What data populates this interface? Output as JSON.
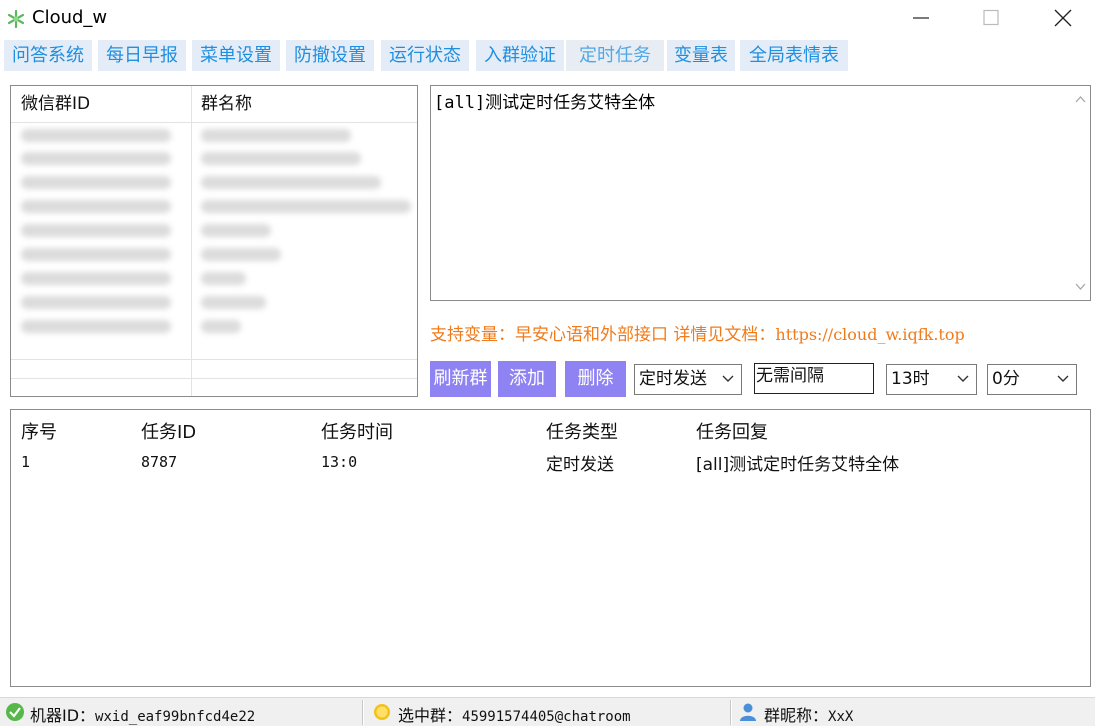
{
  "window": {
    "title": "Cloud_w",
    "app_icon": "snowflake-icon",
    "controls": [
      "minimize-icon",
      "maximize-icon",
      "close-icon"
    ]
  },
  "tabs": [
    {
      "label": "问答系统",
      "active": false
    },
    {
      "label": "每日早报",
      "active": false
    },
    {
      "label": "菜单设置",
      "active": false
    },
    {
      "label": "防撤设置",
      "active": false
    },
    {
      "label": "运行状态",
      "active": false
    },
    {
      "label": "入群验证",
      "active": false
    },
    {
      "label": "定时任务",
      "active": true
    },
    {
      "label": "变量表",
      "active": false
    },
    {
      "label": "全局表情表",
      "active": false
    }
  ],
  "group_table": {
    "columns": [
      "微信群ID",
      "群名称"
    ]
  },
  "message_box": {
    "value": "[all]测试定时任务艾特全体"
  },
  "hint": {
    "prefix": "支持变量：早安心语和外部接口 详情见文档：",
    "url": "https://cloud_w.iqfk.top"
  },
  "buttons": {
    "refresh": "刷新群",
    "add": "添加",
    "delete": "删除"
  },
  "controls": {
    "task_type_selected": "定时发送",
    "interval_value": "无需间隔",
    "hour_selected": "13时",
    "minute_selected": "0分"
  },
  "task_table": {
    "columns": [
      "序号",
      "任务ID",
      "任务时间",
      "任务类型",
      "任务回复"
    ],
    "rows": [
      {
        "index": "1",
        "task_id": "8787",
        "time": "13:0",
        "type": "定时发送",
        "reply": "[all]测试定时任务艾特全体"
      }
    ]
  },
  "status_bar": {
    "robot_label": "机器ID：",
    "robot_value": "wxid_eaf99bnfcd4e22",
    "group_label": "选中群：",
    "group_value": "45991574405@chatroom",
    "nick_label": "群昵称：",
    "nick_value": "XxX"
  },
  "colors": {
    "tab_bg": "#e4ecf7",
    "tab_text": "#1f8fe0",
    "button_bg": "#8f83f3",
    "hint_text": "#f07b1a"
  }
}
